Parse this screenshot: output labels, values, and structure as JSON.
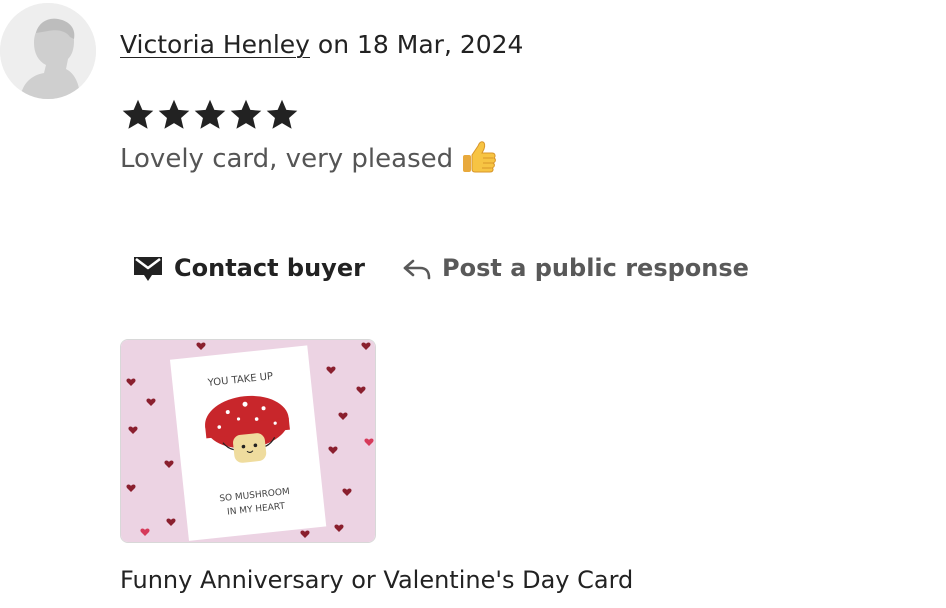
{
  "review": {
    "reviewer_name": "Victoria Henley",
    "date_text": " on 18 Mar, 2024",
    "rating": 5,
    "rating_max": 5,
    "text": "Lovely card, very pleased",
    "emoji_icon": "thumbs-up-icon"
  },
  "actions": {
    "contact_label": "Contact buyer",
    "contact_icon": "envelope-icon",
    "respond_label": "Post a public response",
    "respond_icon": "reply-arrow-icon"
  },
  "product": {
    "title": "Funny Anniversary or Valentine's Day Card",
    "card_line1": "YOU TAKE UP",
    "card_line2": "SO MUSHROOM",
    "card_line3": "IN MY HEART"
  },
  "colors": {
    "text_primary": "#222222",
    "text_secondary": "#595959",
    "thumb_background": "#ecd3e3",
    "mushroom_cap": "#c8262b"
  }
}
